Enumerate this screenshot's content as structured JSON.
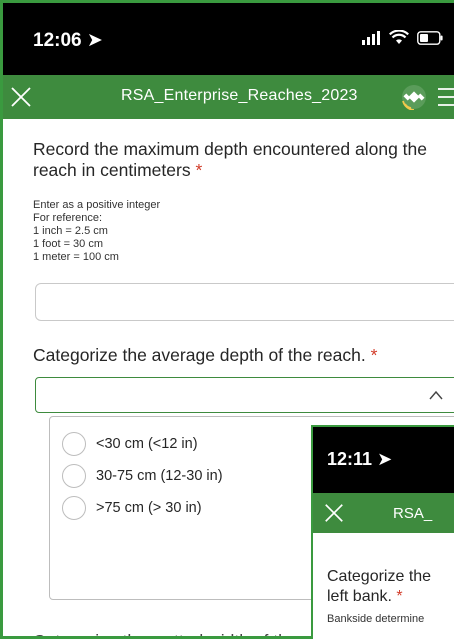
{
  "status_bar": {
    "time": "12:06"
  },
  "app_bar": {
    "title": "RSA_Enterprise_Reaches_2023"
  },
  "question1": {
    "label": "Record the maximum depth encountered along the reach in centimeters",
    "required_mark": "*",
    "hint_lines": [
      "Enter as a positive integer",
      "For reference:",
      "1 inch = 2.5 cm",
      "1 foot = 30 cm",
      "1 meter = 100 cm"
    ],
    "value": ""
  },
  "question2": {
    "label": "Categorize the average depth of the reach.",
    "required_mark": "*",
    "selected": "",
    "options": [
      "<30 cm (<12 in)",
      "30-75 cm (12-30 in)",
      ">75 cm (> 30 in)"
    ]
  },
  "question3": {
    "label": "Categorize the wetted width of th"
  },
  "overlay": {
    "time": "12:11",
    "title": "RSA_",
    "question_line1": "Categorize the",
    "question_line2": "left bank.",
    "required_mark": "*",
    "hint": "Bankside determine"
  },
  "colors": {
    "app_bar": "#3e8b3e",
    "required": "#d23c2a",
    "frame_border": "#3a9a3f"
  }
}
